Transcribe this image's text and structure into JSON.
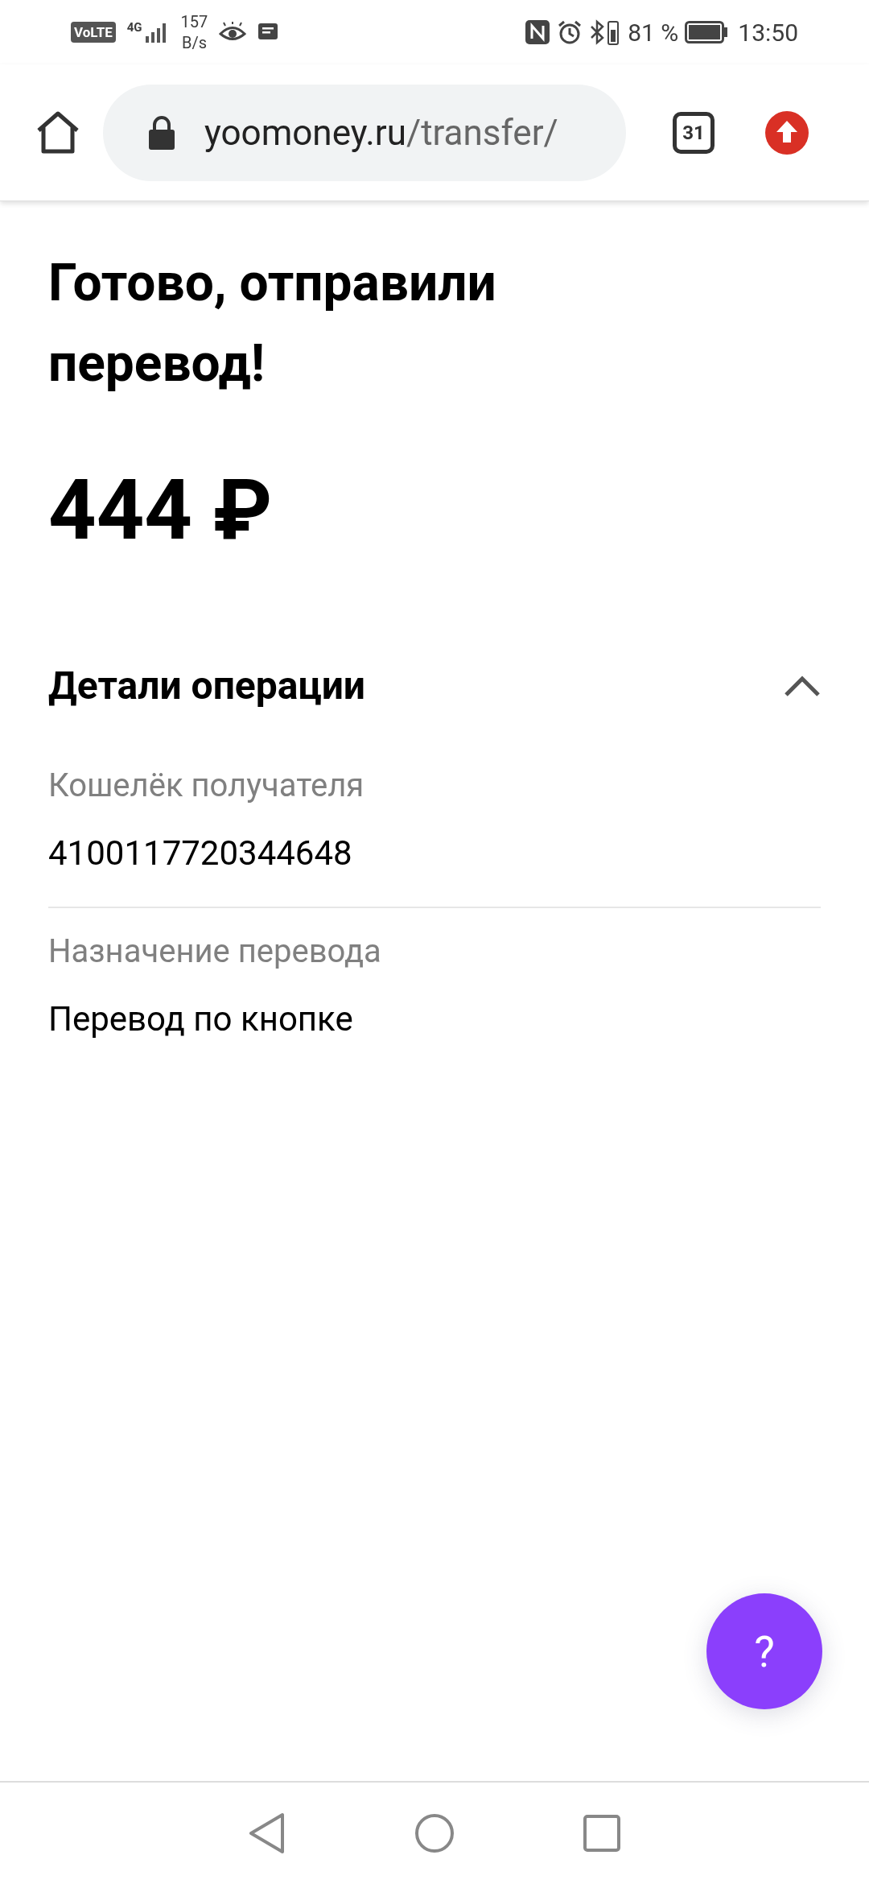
{
  "status_bar": {
    "volte": "VoLTE",
    "network": "4G",
    "speed_value": "157",
    "speed_unit": "B/s",
    "battery_percent": "81 %",
    "time": "13:50"
  },
  "browser": {
    "url_host": "yoomoney.ru",
    "url_path": "/transfer/",
    "tab_count": "31"
  },
  "page": {
    "title": "Готово, отправили перевод!",
    "amount": "444 ₽",
    "details": {
      "heading": "Детали операции",
      "expanded": true,
      "rows": [
        {
          "label": "Кошелёк получателя",
          "value": "4100117720344648"
        },
        {
          "label": "Назначение перевода",
          "value": "Перевод по кнопке"
        }
      ]
    }
  },
  "help_button": {
    "label": "?"
  }
}
